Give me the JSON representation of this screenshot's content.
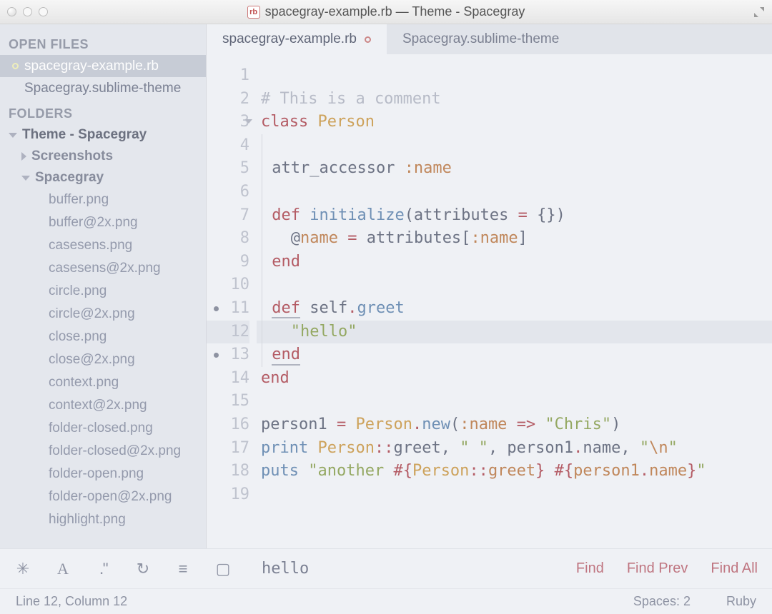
{
  "window": {
    "title": "spacegray-example.rb — Theme - Spacegray",
    "badge": "rb"
  },
  "sidebar": {
    "headings": {
      "open_files": "OPEN FILES",
      "folders": "FOLDERS"
    },
    "open_files": [
      {
        "name": "spacegray-example.rb",
        "dirty": true,
        "active": true
      },
      {
        "name": "Spacegray.sublime-theme",
        "dirty": false,
        "active": false
      }
    ],
    "project": "Theme - Spacegray",
    "folders": [
      {
        "name": "Screenshots",
        "expanded": false
      },
      {
        "name": "Spacegray",
        "expanded": true
      }
    ],
    "files": [
      "buffer.png",
      "buffer@2x.png",
      "casesens.png",
      "casesens@2x.png",
      "circle.png",
      "circle@2x.png",
      "close.png",
      "close@2x.png",
      "context.png",
      "context@2x.png",
      "folder-closed.png",
      "folder-closed@2x.png",
      "folder-open.png",
      "folder-open@2x.png",
      "highlight.png"
    ]
  },
  "tabs": [
    {
      "label": "spacegray-example.rb",
      "dirty": true,
      "active": true
    },
    {
      "label": "Spacegray.sublime-theme",
      "dirty": false,
      "active": false
    }
  ],
  "editor": {
    "highlighted_line": 12,
    "marked_lines": [
      11,
      13
    ],
    "fold_lines": [
      3
    ],
    "lines": [
      {
        "n": 1,
        "tokens": []
      },
      {
        "n": 2,
        "tokens": [
          {
            "c": "comment",
            "t": "# This is a comment"
          }
        ]
      },
      {
        "n": 3,
        "tokens": [
          {
            "c": "kw",
            "t": "class "
          },
          {
            "c": "const",
            "t": "Person"
          }
        ]
      },
      {
        "n": 4,
        "tokens": [],
        "indent": 1
      },
      {
        "n": 5,
        "tokens": [
          {
            "c": "txt",
            "t": "attr_accessor "
          },
          {
            "c": "sym",
            "t": ":name"
          }
        ],
        "indent": 1
      },
      {
        "n": 6,
        "tokens": [],
        "indent": 1
      },
      {
        "n": 7,
        "tokens": [
          {
            "c": "kw",
            "t": "def "
          },
          {
            "c": "fn",
            "t": "initialize"
          },
          {
            "c": "txt",
            "t": "(attributes "
          },
          {
            "c": "kw",
            "t": "="
          },
          {
            "c": "txt",
            "t": " {})"
          }
        ],
        "indent": 1
      },
      {
        "n": 8,
        "tokens": [
          {
            "c": "txt",
            "t": "  @"
          },
          {
            "c": "attr",
            "t": "name"
          },
          {
            "c": "txt",
            "t": " "
          },
          {
            "c": "kw",
            "t": "="
          },
          {
            "c": "txt",
            "t": " attributes["
          },
          {
            "c": "sym",
            "t": ":name"
          },
          {
            "c": "txt",
            "t": "]"
          }
        ],
        "indent": 1
      },
      {
        "n": 9,
        "tokens": [
          {
            "c": "kw",
            "t": "end"
          }
        ],
        "indent": 1
      },
      {
        "n": 10,
        "tokens": [],
        "indent": 1
      },
      {
        "n": 11,
        "tokens": [
          {
            "c": "kw underline",
            "t": "def"
          },
          {
            "c": "txt",
            "t": " self"
          },
          {
            "c": "kw",
            "t": "."
          },
          {
            "c": "fn",
            "t": "greet"
          }
        ],
        "indent": 1
      },
      {
        "n": 12,
        "tokens": [
          {
            "c": "txt",
            "t": "  "
          },
          {
            "c": "str",
            "t": "\""
          },
          {
            "c": "str",
            "t": "hello"
          },
          {
            "c": "str",
            "t": "\""
          }
        ],
        "indent": 1
      },
      {
        "n": 13,
        "tokens": [
          {
            "c": "kw underline2",
            "t": "end"
          }
        ],
        "indent": 1
      },
      {
        "n": 14,
        "tokens": [
          {
            "c": "kw",
            "t": "end"
          }
        ]
      },
      {
        "n": 15,
        "tokens": []
      },
      {
        "n": 16,
        "tokens": [
          {
            "c": "txt",
            "t": "person1 "
          },
          {
            "c": "kw",
            "t": "="
          },
          {
            "c": "txt",
            "t": " "
          },
          {
            "c": "const",
            "t": "Person"
          },
          {
            "c": "kw",
            "t": "."
          },
          {
            "c": "fn",
            "t": "new"
          },
          {
            "c": "txt",
            "t": "("
          },
          {
            "c": "sym",
            "t": ":name"
          },
          {
            "c": "txt",
            "t": " "
          },
          {
            "c": "kw",
            "t": "=>"
          },
          {
            "c": "txt",
            "t": " "
          },
          {
            "c": "str",
            "t": "\"Chris\""
          },
          {
            "c": "txt",
            "t": ")"
          }
        ]
      },
      {
        "n": 17,
        "tokens": [
          {
            "c": "fn",
            "t": "print"
          },
          {
            "c": "txt",
            "t": " "
          },
          {
            "c": "const",
            "t": "Person"
          },
          {
            "c": "kw",
            "t": "::"
          },
          {
            "c": "txt",
            "t": "greet, "
          },
          {
            "c": "str",
            "t": "\" \""
          },
          {
            "c": "txt",
            "t": ", person1"
          },
          {
            "c": "kw",
            "t": "."
          },
          {
            "c": "txt",
            "t": "name, "
          },
          {
            "c": "str",
            "t": "\""
          },
          {
            "c": "escape",
            "t": "\\n"
          },
          {
            "c": "str",
            "t": "\""
          }
        ]
      },
      {
        "n": 18,
        "tokens": [
          {
            "c": "fn",
            "t": "puts"
          },
          {
            "c": "txt",
            "t": " "
          },
          {
            "c": "str",
            "t": "\"another "
          },
          {
            "c": "interp",
            "t": "#{"
          },
          {
            "c": "const",
            "t": "Person"
          },
          {
            "c": "kw",
            "t": "::"
          },
          {
            "c": "interp-id",
            "t": "greet"
          },
          {
            "c": "interp",
            "t": "}"
          },
          {
            "c": "str",
            "t": " "
          },
          {
            "c": "interp",
            "t": "#{"
          },
          {
            "c": "interp-id",
            "t": "person1"
          },
          {
            "c": "kw",
            "t": "."
          },
          {
            "c": "interp-id",
            "t": "name"
          },
          {
            "c": "interp",
            "t": "}"
          },
          {
            "c": "str",
            "t": "\""
          }
        ]
      },
      {
        "n": 19,
        "tokens": []
      }
    ]
  },
  "find": {
    "query": "hello",
    "buttons": {
      "find": "Find",
      "prev": "Find Prev",
      "all": "Find All"
    }
  },
  "status": {
    "position": "Line 12, Column 12",
    "spaces": "Spaces: 2",
    "syntax": "Ruby"
  }
}
